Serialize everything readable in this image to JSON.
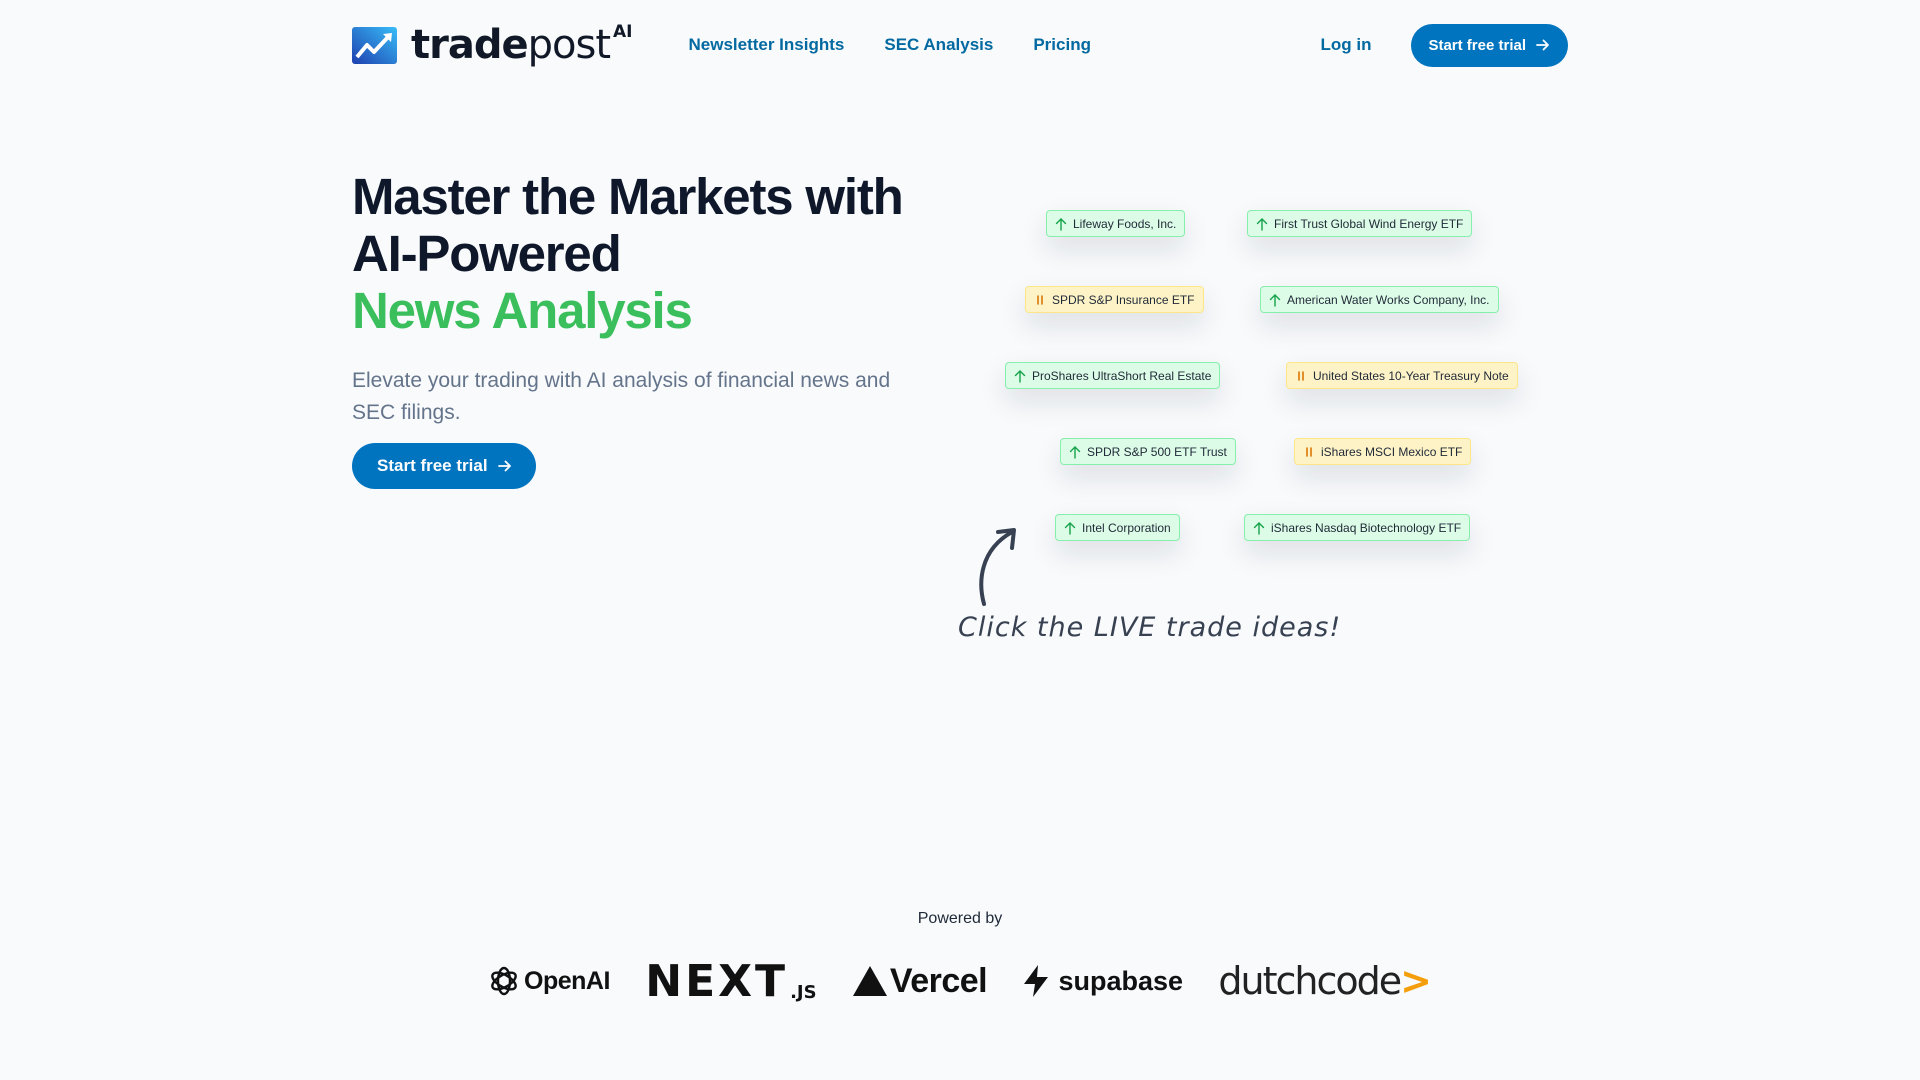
{
  "nav": {
    "brand_main": "trade",
    "brand_light": "post",
    "brand_sup": "AI",
    "links": [
      {
        "label": "Newsletter Insights"
      },
      {
        "label": "SEC Analysis"
      },
      {
        "label": "Pricing"
      }
    ],
    "login": "Log in",
    "cta": "Start free trial"
  },
  "hero": {
    "title_line1": "Master the Markets with",
    "title_line2": "AI-Powered",
    "title_highlight": "News Analysis",
    "subtitle": "Elevate your trading with AI analysis of financial news and SEC filings.",
    "cta": "Start free trial"
  },
  "trade_ideas": [
    {
      "label": "Lifeway Foods, Inc.",
      "signal": "up",
      "icon": "arrow-up-icon"
    },
    {
      "label": "First Trust Global Wind Energy ETF",
      "signal": "up",
      "icon": "arrow-up-icon"
    },
    {
      "label": "SPDR S&P Insurance ETF",
      "signal": "hold",
      "icon": "pause-icon"
    },
    {
      "label": "American Water Works Company, Inc.",
      "signal": "up",
      "icon": "arrow-up-icon"
    },
    {
      "label": "ProShares UltraShort Real Estate",
      "signal": "up",
      "icon": "arrow-up-icon"
    },
    {
      "label": "United States 10-Year Treasury Note",
      "signal": "hold",
      "icon": "pause-icon"
    },
    {
      "label": "SPDR S&P 500 ETF Trust",
      "signal": "up",
      "icon": "arrow-up-icon"
    },
    {
      "label": "iShares MSCI Mexico ETF",
      "signal": "hold",
      "icon": "pause-icon"
    },
    {
      "label": "Intel Corporation",
      "signal": "up",
      "icon": "arrow-up-icon"
    },
    {
      "label": "iShares Nasdaq Biotechnology ETF",
      "signal": "up",
      "icon": "arrow-up-icon"
    }
  ],
  "callout": "Click the LIVE trade ideas!",
  "powered_by": {
    "label": "Powered by",
    "partners": [
      {
        "name": "OpenAI"
      },
      {
        "name": "NEXT",
        "suffix": ".JS"
      },
      {
        "name": "Vercel"
      },
      {
        "name": "supabase"
      },
      {
        "name": "dutchcode",
        "suffix": ">"
      }
    ]
  },
  "colors": {
    "accent_blue": "#0074bf",
    "link_blue": "#0369a1",
    "highlight_green": "#3bbf5c",
    "up_tag_bg": "#dcfce7",
    "hold_tag_bg": "#fef3c7"
  }
}
